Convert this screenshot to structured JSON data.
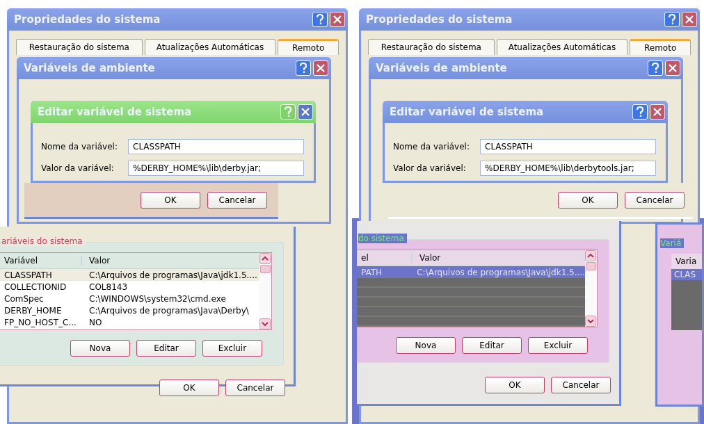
{
  "panels": [
    {
      "kind": "plain",
      "system_properties": {
        "title": "Propriedades do sistema",
        "tabs": [
          {
            "label": "Restauração do sistema",
            "selected": false
          },
          {
            "label": "Atualizações Automáticas",
            "selected": false
          },
          {
            "label": "Remoto",
            "selected": true
          }
        ]
      },
      "environment_variables": {
        "title": "Variáveis de ambiente"
      },
      "edit_dialog": {
        "title": "Editar variável de sistema",
        "fields": [
          {
            "label": "Nome da variável:",
            "value": "CLASSPATH"
          },
          {
            "label": "Valor da variável:",
            "value": "%DERBY_HOME%\\lib\\derby.jar;"
          }
        ],
        "buttons": [
          "OK",
          "Cancelar"
        ]
      },
      "system_variables": {
        "group_label": "ariáveis do sistema",
        "columns": [
          "Variável",
          "Valor"
        ],
        "rows": [
          {
            "cells": [
              "CLASSPATH",
              "C:\\Arquivos de programas\\Java\\jdk1.5...."
            ],
            "selected": true
          },
          {
            "cells": [
              "COLLECTIONID",
              "COL8143"
            ],
            "selected": false
          },
          {
            "cells": [
              "ComSpec",
              "C:\\WINDOWS\\system32\\cmd.exe"
            ],
            "selected": false
          },
          {
            "cells": [
              "DERBY_HOME",
              "C:\\Arquivos de programas\\Java\\Derby\\"
            ],
            "selected": false
          },
          {
            "cells": [
              "FP_NO_HOST_C...",
              "NO"
            ],
            "selected": false
          }
        ],
        "buttons": [
          "Nova",
          "Editar",
          "Excluir"
        ],
        "dialog_buttons": [
          "OK",
          "Cancelar"
        ]
      }
    },
    {
      "kind": "glitched",
      "system_properties": {
        "title": "Propriedades do sistema",
        "tabs": [
          {
            "label": "Restauração do sistema",
            "selected": false
          },
          {
            "label": "Atualizações Automáticas",
            "selected": false
          },
          {
            "label": "Remoto",
            "selected": true
          }
        ]
      },
      "environment_variables": {
        "title": "Variáveis de ambiente"
      },
      "edit_dialog": {
        "title": "Editar variável de sistema",
        "fields": [
          {
            "label": "Nome da variável:",
            "value": "CLASSPATH"
          },
          {
            "label": "Valor da variável:",
            "value": "%DERBY_HOME%\\lib\\derbytools.jar;"
          }
        ],
        "buttons": [
          "OK",
          "Cancelar"
        ]
      },
      "system_variables": {
        "group_label": "do sistema",
        "columns": [
          "el",
          "Valor"
        ],
        "rows": [
          {
            "cells": [
              "PATH",
              "C:\\Arquivos de programas\\Java\\jdk1.5...."
            ],
            "selected": true
          }
        ],
        "buttons": [
          "Nova",
          "Editar",
          "Excluir"
        ],
        "dialog_buttons": [
          "OK",
          "Cancelar"
        ]
      },
      "side_window": {
        "group_label": "Variá",
        "column": "Varia",
        "row": "CLAS"
      }
    }
  ]
}
